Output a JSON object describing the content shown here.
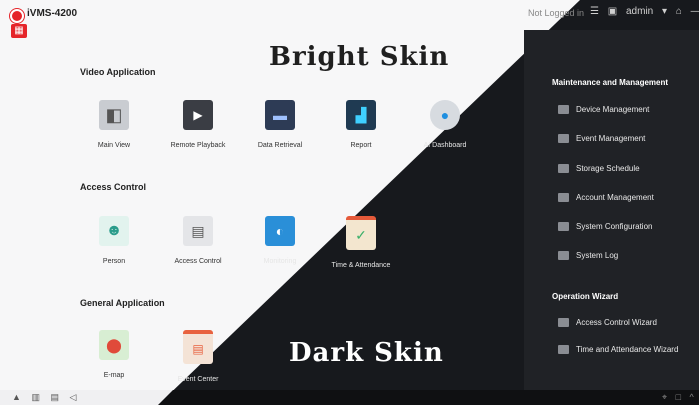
{
  "app": {
    "title": "iVMS-4200",
    "home_icon": "grid-icon"
  },
  "header": {
    "status": "Not Logged in",
    "user": "admin",
    "icons": [
      "cloud-icon",
      "list-icon",
      "monitor-icon",
      "lock-icon",
      "minimize-icon",
      "maximize-icon"
    ]
  },
  "labels": {
    "bright": "Bright Skin",
    "dark": "Dark Skin"
  },
  "sections": {
    "video": {
      "title": "Video Application",
      "items": [
        {
          "label": "Main View",
          "icon": "camera-icon"
        },
        {
          "label": "Remote Playback",
          "icon": "playback-icon"
        },
        {
          "label": "Data Retrieval",
          "icon": "monitor-icon"
        },
        {
          "label": "Report",
          "icon": "chart-icon"
        },
        {
          "label": "AI Dashboard",
          "icon": "ai-camera-icon"
        }
      ]
    },
    "access": {
      "title": "Access Control",
      "items": [
        {
          "label": "Person",
          "icon": "person-icon"
        },
        {
          "label": "Access Control",
          "icon": "door-station-icon"
        },
        {
          "label": "Monitoring",
          "icon": "monitoring-icon"
        },
        {
          "label": "Time & Attendance",
          "icon": "calendar-icon"
        }
      ]
    },
    "general": {
      "title": "General Application",
      "items": [
        {
          "label": "E-map",
          "icon": "map-icon"
        },
        {
          "label": "Event Center",
          "icon": "event-center-icon"
        }
      ]
    }
  },
  "maintenance": {
    "title": "Maintenance and Management",
    "items": [
      {
        "label": "Device Management",
        "icon": "device-icon"
      },
      {
        "label": "Event Management",
        "icon": "event-icon"
      },
      {
        "label": "Storage Schedule",
        "icon": "storage-icon"
      },
      {
        "label": "Account Management",
        "icon": "account-icon"
      },
      {
        "label": "System Configuration",
        "icon": "config-icon"
      },
      {
        "label": "System Log",
        "icon": "log-icon"
      }
    ]
  },
  "wizard": {
    "title": "Operation Wizard",
    "items": [
      {
        "label": "Access Control Wizard",
        "icon": "wizard-icon"
      },
      {
        "label": "Time and Attendance Wizard",
        "icon": "wizard-icon"
      }
    ]
  },
  "bottombar": {
    "left_icons": [
      "warning-icon",
      "trash-icon",
      "list-icon",
      "speaker-icon"
    ],
    "right_icons": [
      "pin-icon",
      "window-icon",
      "chevron-up-icon"
    ]
  }
}
